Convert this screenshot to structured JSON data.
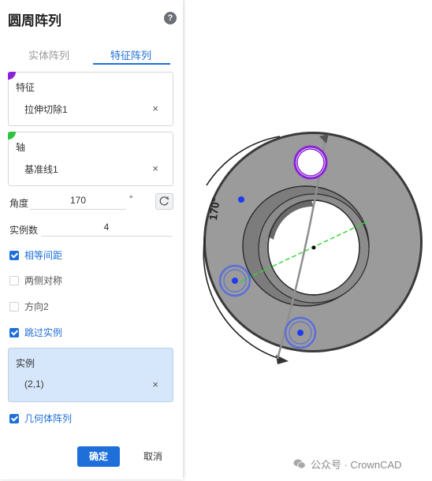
{
  "panel": {
    "title": "圆周阵列",
    "help_icon": "?",
    "tabs": [
      "实体阵列",
      "特征阵列"
    ],
    "active_tab": "特征阵列",
    "feature": {
      "label": "特征",
      "value": "拉伸切除1",
      "clear": "×"
    },
    "axis": {
      "label": "轴",
      "value": "基准线1",
      "clear": "×"
    },
    "angle": {
      "label": "角度",
      "value": "170",
      "unit": "°"
    },
    "count": {
      "label": "实例数",
      "value": "4"
    },
    "options": [
      {
        "label": "相等间距",
        "checked": true
      },
      {
        "label": "两侧对称",
        "checked": false
      },
      {
        "label": "方向2",
        "checked": false
      },
      {
        "label": "跳过实例",
        "checked": true
      }
    ],
    "instances": {
      "label": "实例",
      "value": "(2,1)",
      "clear": "×"
    },
    "geometry_pattern": {
      "label": "几何体阵列",
      "checked": true
    },
    "ok_label": "确定",
    "cancel_label": "取消"
  },
  "viewport": {
    "angle_annotation": "170°"
  },
  "watermark": {
    "text": "公众号 · CrownCAD"
  },
  "colors": {
    "accent": "#1e6fd9",
    "feature_marker": "#8a22d6",
    "axis_marker": "#2fc43f",
    "part_gray": "#9b9b9b"
  }
}
